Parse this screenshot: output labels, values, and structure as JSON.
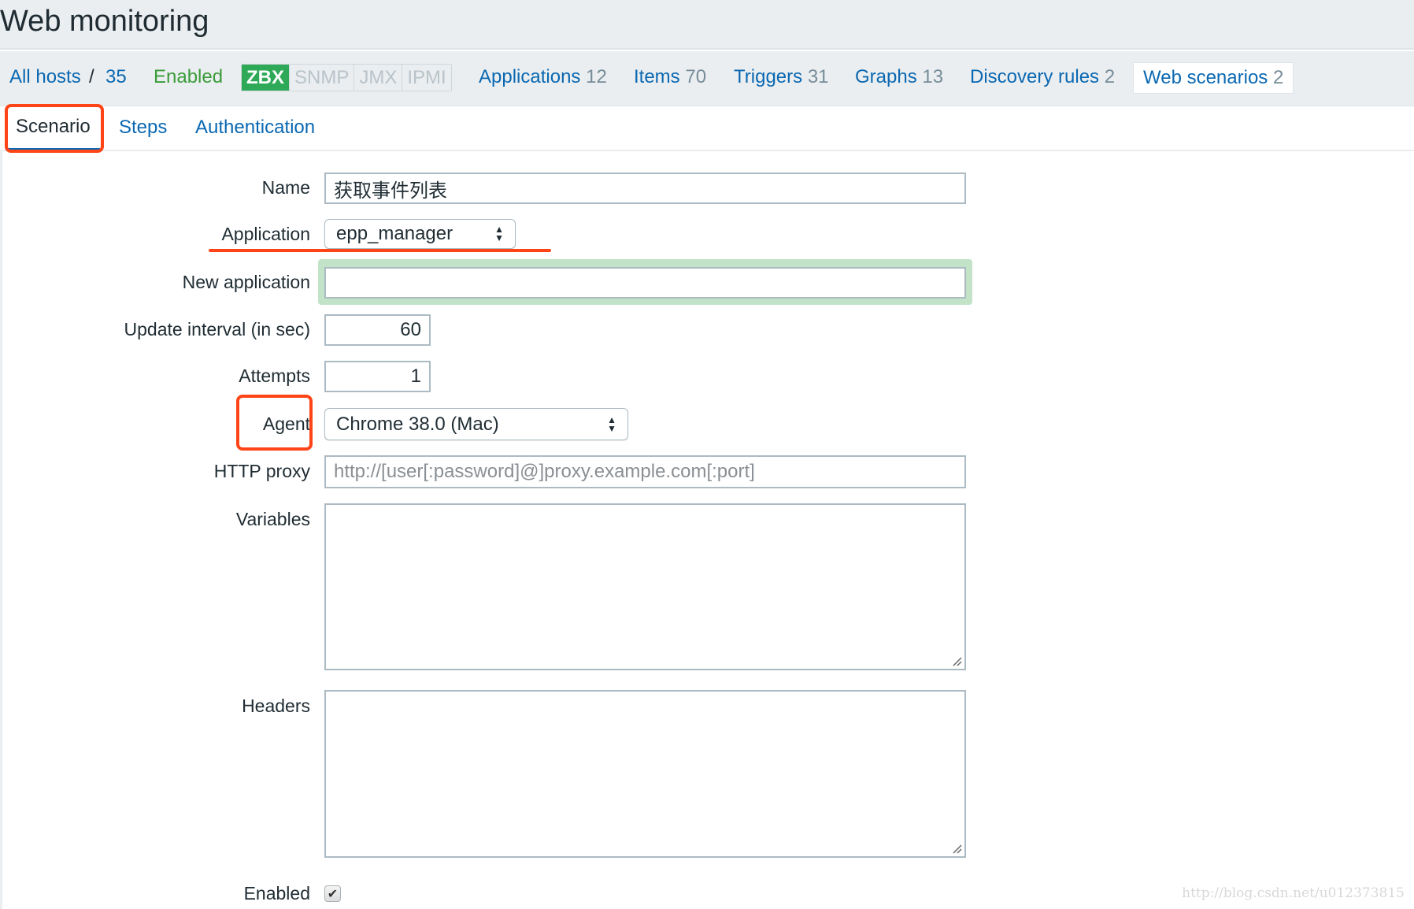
{
  "header": {
    "title": "Web monitoring"
  },
  "nav": {
    "all_hosts": "All hosts",
    "separator": "/",
    "host": "35",
    "status": "Enabled",
    "availability": [
      {
        "label": "ZBX",
        "active": true
      },
      {
        "label": "SNMP",
        "active": false
      },
      {
        "label": "JMX",
        "active": false
      },
      {
        "label": "IPMI",
        "active": false
      }
    ],
    "links": [
      {
        "label": "Applications",
        "count": "12"
      },
      {
        "label": "Items",
        "count": "70"
      },
      {
        "label": "Triggers",
        "count": "31"
      },
      {
        "label": "Graphs",
        "count": "13"
      },
      {
        "label": "Discovery rules",
        "count": "2"
      },
      {
        "label": "Web scenarios",
        "count": "2"
      }
    ]
  },
  "tabs": [
    {
      "label": "Scenario",
      "active": true
    },
    {
      "label": "Steps",
      "active": false
    },
    {
      "label": "Authentication",
      "active": false
    }
  ],
  "form": {
    "name": {
      "label": "Name",
      "value": "获取事件列表"
    },
    "application": {
      "label": "Application",
      "value": "epp_manager"
    },
    "new_application": {
      "label": "New application",
      "value": ""
    },
    "update_interval": {
      "label": "Update interval (in sec)",
      "value": "60"
    },
    "attempts": {
      "label": "Attempts",
      "value": "1"
    },
    "agent": {
      "label": "Agent",
      "value": "Chrome 38.0 (Mac)"
    },
    "http_proxy": {
      "label": "HTTP proxy",
      "value": "",
      "placeholder": "http://[user[:password]@]proxy.example.com[:port]"
    },
    "variables": {
      "label": "Variables",
      "value": ""
    },
    "headers": {
      "label": "Headers",
      "value": ""
    },
    "enabled": {
      "label": "Enabled",
      "checked": true,
      "glyph": "✔"
    }
  },
  "watermark": "http://blog.csdn.net/u012373815",
  "colors": {
    "link": "#0a68b2",
    "enabled": "#3a9c3a",
    "zbx": "#2ea957",
    "annotation": "#ff4517",
    "focus": "#c3e3c8"
  }
}
